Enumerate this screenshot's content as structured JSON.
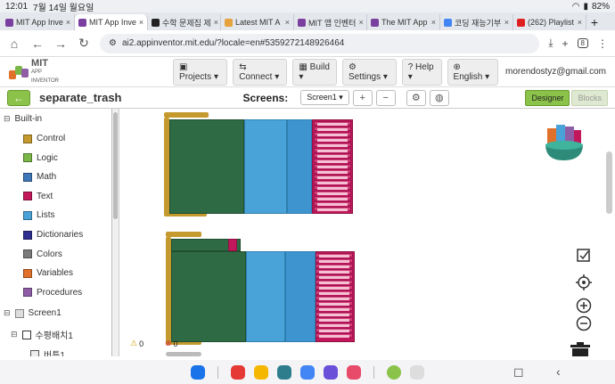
{
  "status": {
    "time": "12:01",
    "date": "7월 14일 월요일",
    "battery": "82%"
  },
  "tabs": [
    {
      "label": "MIT App Inve",
      "color": "#7b3fa0"
    },
    {
      "label": "MIT App Inve",
      "color": "#7b3fa0"
    },
    {
      "label": "수학 문제집 제",
      "color": "#222222"
    },
    {
      "label": "Latest MIT A",
      "color": "#e6a23c"
    },
    {
      "label": "MIT 앱 인벤터",
      "color": "#7b3fa0"
    },
    {
      "label": "The MIT App",
      "color": "#7b3fa0"
    },
    {
      "label": "코딩 재능기부",
      "color": "#4285f4"
    },
    {
      "label": "(262) Playlist",
      "color": "#e02020"
    }
  ],
  "address": {
    "url": "ai2.appinventor.mit.edu/?locale=en#5359272148926464",
    "tab_count": "8"
  },
  "header": {
    "logo_title": "MIT",
    "logo_sub": "APP INVENTOR",
    "menus": [
      "Projects",
      "Connect",
      "Build",
      "Settings",
      "Help",
      "English"
    ],
    "account": "morendostyz@gmail.com"
  },
  "project": {
    "name": "separate_trash",
    "screens_label": "Screens:",
    "screen": "Screen1",
    "designer": "Designer",
    "blocks": "Blocks"
  },
  "sidebar": {
    "builtin": "Built-in",
    "categories": [
      {
        "label": "Control",
        "color": "#c49a2e"
      },
      {
        "label": "Logic",
        "color": "#7ab648"
      },
      {
        "label": "Math",
        "color": "#3e76b8"
      },
      {
        "label": "Text",
        "color": "#c2185b"
      },
      {
        "label": "Lists",
        "color": "#4aa3d8"
      },
      {
        "label": "Dictionaries",
        "color": "#2e2e8f"
      },
      {
        "label": "Colors",
        "color": "#7a7a7a"
      },
      {
        "label": "Variables",
        "color": "#e0702a"
      },
      {
        "label": "Procedures",
        "color": "#8e5da6"
      }
    ],
    "screen1": "Screen1",
    "arrangement": "수평배치1",
    "button": "버튼1"
  },
  "warnings": {
    "warn_count": "0",
    "error_count": "0"
  }
}
